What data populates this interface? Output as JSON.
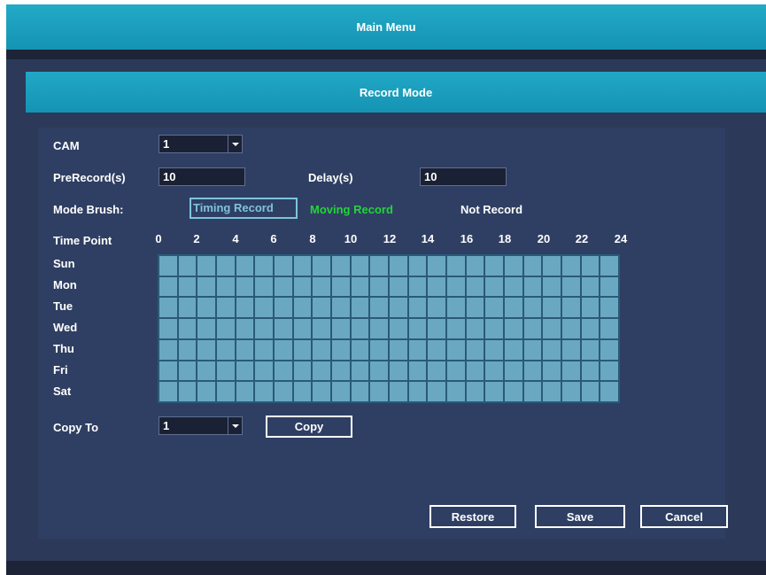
{
  "topbar": {
    "title": "Main Menu"
  },
  "dialog": {
    "title": "Record Mode"
  },
  "form": {
    "cam_label": "CAM",
    "cam_value": "1",
    "prerecord_label": "PreRecord(s)",
    "prerecord_value": "10",
    "delay_label": "Delay(s)",
    "delay_value": "10",
    "mode_brush_label": "Mode Brush:",
    "brush_options": [
      "Timing Record",
      "Moving Record",
      "Not Record"
    ],
    "brush_selected": "Timing Record",
    "brush_colors": {
      "timing": "#7ec3dc",
      "moving": "#22d43a",
      "not": "#ffffff"
    }
  },
  "schedule": {
    "time_point_label": "Time Point",
    "hour_ticks": [
      "0",
      "2",
      "4",
      "6",
      "8",
      "10",
      "12",
      "14",
      "16",
      "18",
      "20",
      "22",
      "24"
    ],
    "days": [
      "Sun",
      "Mon",
      "Tue",
      "Wed",
      "Thu",
      "Fri",
      "Sat"
    ],
    "cell_color": "#6aa8c2",
    "mode_per_cell": "Timing Record"
  },
  "copy": {
    "label": "Copy To",
    "value": "1",
    "button_label": "Copy"
  },
  "buttons": {
    "restore": "Restore",
    "save": "Save",
    "cancel": "Cancel"
  }
}
